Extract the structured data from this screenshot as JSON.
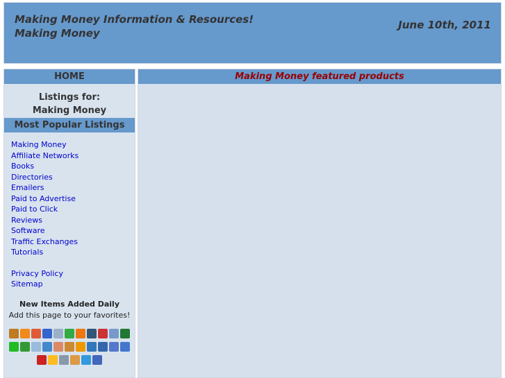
{
  "header": {
    "title_line1": "Making Money Information & Resources!",
    "title_line2": "Making Money",
    "date": "June 10th, 2011"
  },
  "sidebar": {
    "home_label": "HOME",
    "listings_for": "Listings for:",
    "category": "Making Money",
    "popular_head": "Most Popular Listings",
    "links": [
      "Making Money",
      "Affiliate Networks",
      "Books",
      "Directories",
      "Emailers",
      "Paid to Advertise",
      "Paid to Click",
      "Reviews",
      "Software",
      "Traffic Exchanges",
      "Tutorials"
    ],
    "footer_links": [
      "Privacy Policy",
      "Sitemap"
    ],
    "new_items": "New Items Added Daily",
    "add_favorites": "Add this page to your favorites!",
    "bookmark_icons": [
      {
        "name": "squirl-icon",
        "color": "#c07a20"
      },
      {
        "name": "blinklist-icon",
        "color": "#f08a1c"
      },
      {
        "name": "blogmarks-icon",
        "color": "#e05a3a"
      },
      {
        "name": "delicious-icon",
        "color": "#3366cc"
      },
      {
        "name": "diigo-icon",
        "color": "#9ab0c8"
      },
      {
        "name": "feedmelinks-icon",
        "color": "#33aa44"
      },
      {
        "name": "furl-icon",
        "color": "#ee7711"
      },
      {
        "name": "linkagogo-icon",
        "color": "#335577"
      },
      {
        "name": "yahoo-myweb-icon",
        "color": "#cc3333"
      },
      {
        "name": "magnolia-icon",
        "color": "#7799cc"
      },
      {
        "name": "newsvine-icon",
        "color": "#227733"
      },
      {
        "name": "netvouz-icon",
        "color": "#22bb22"
      },
      {
        "name": "reddit-icon",
        "color": "#339933"
      },
      {
        "name": "rojo-icon",
        "color": "#99bbdd"
      },
      {
        "name": "segnalo-icon",
        "color": "#4488cc"
      },
      {
        "name": "shadows-icon",
        "color": "#dd8866"
      },
      {
        "name": "simpy-icon",
        "color": "#cc8833"
      },
      {
        "name": "spurl-icon",
        "color": "#ee9900"
      },
      {
        "name": "netscape-icon",
        "color": "#3377bb"
      },
      {
        "name": "stumbleupon-icon",
        "color": "#3366aa"
      },
      {
        "name": "tailrank-icon",
        "color": "#5577cc"
      },
      {
        "name": "technorati-icon",
        "color": "#4477cc"
      },
      {
        "name": "thumbtack-icon",
        "color": "#cc2222"
      },
      {
        "name": "wink-icon",
        "color": "#ffbb22"
      },
      {
        "name": "wists-icon",
        "color": "#8899aa"
      },
      {
        "name": "bluedot-icon",
        "color": "#dd9944"
      },
      {
        "name": "connotea-icon",
        "color": "#3399dd"
      },
      {
        "name": "google-icon",
        "color": "#4466bb"
      }
    ]
  },
  "main": {
    "heading": "Making Money featured products"
  }
}
